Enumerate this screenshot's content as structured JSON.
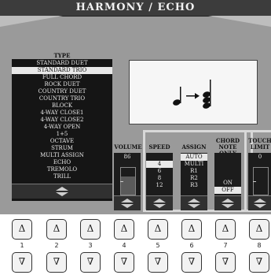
{
  "title": "HARMONY / ECHO",
  "type_list": {
    "label": "TYPE",
    "items": [
      "STANDARD DUET",
      "STANDARD TRIO",
      "FULL CHORD",
      "ROCK DUET",
      "COUNTRY DUET",
      "COUNTRY TRIO",
      "BLOCK",
      "4-WAY CLOSE1",
      "4-WAY CLOSE2",
      "4-WAY OPEN",
      "1+5",
      "OCTAVE",
      "STRUM",
      "MULTI ASSIGN",
      "ECHO",
      "TREMOLO",
      "TRILL"
    ],
    "selected_index": 1
  },
  "icon_panel": {
    "icon": "note-to-chord-icon"
  },
  "columns": {
    "volume": {
      "label": "VOLUME",
      "value": "86",
      "level": 0.67
    },
    "speed": {
      "label": "SPEED",
      "items": [
        "4",
        "6",
        "8",
        "12"
      ],
      "selected_index": 0
    },
    "assign": {
      "label": "ASSIGN",
      "items": [
        "AUTO",
        "MULTI",
        "R1",
        "R2",
        "R3"
      ],
      "selected_index": 0
    },
    "chord_note_only": {
      "label_line1": "CHORD",
      "label_line2": "NOTE ONLY",
      "items": [
        "ON",
        "OFF"
      ],
      "selected_index": 1
    },
    "touch_limit": {
      "label_line1": "TOUCH",
      "label_line2": "LIMIT",
      "value": "0"
    }
  },
  "buttons": {
    "numbers": [
      "1",
      "2",
      "3",
      "4",
      "5",
      "6",
      "7",
      "8"
    ],
    "up_glyph": "Δ",
    "down_glyph": "∇"
  }
}
